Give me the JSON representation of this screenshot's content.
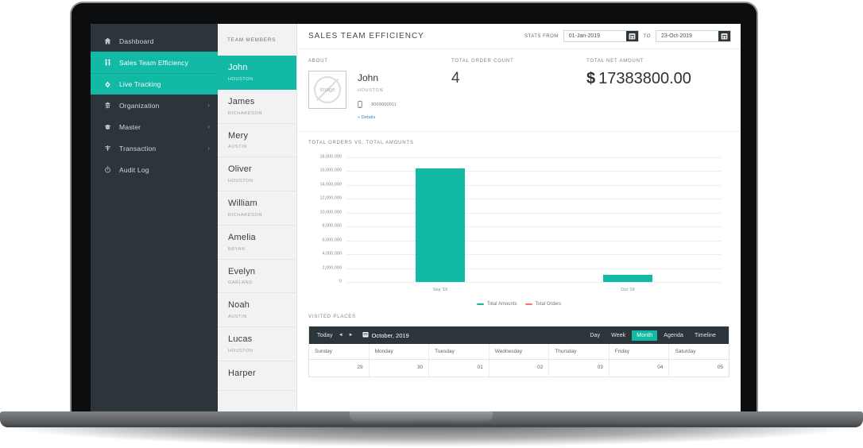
{
  "accent_color": "#12b9a4",
  "sidebar_color": "#2c3539",
  "sidebar": {
    "items": [
      {
        "label": "Dashboard",
        "icon": "home-icon",
        "active": false,
        "caret": ""
      },
      {
        "label": "Sales Team Efficiency",
        "icon": "people-icon",
        "active": true,
        "caret": ""
      },
      {
        "label": "Live Tracking",
        "icon": "location-icon",
        "active": true,
        "caret": ""
      },
      {
        "label": "Organization",
        "icon": "org-icon",
        "active": false,
        "caret": "›"
      },
      {
        "label": "Master",
        "icon": "master-icon",
        "active": false,
        "caret": "›"
      },
      {
        "label": "Transaction",
        "icon": "transaction-icon",
        "active": false,
        "caret": "›"
      },
      {
        "label": "Audit Log",
        "icon": "clock-icon",
        "active": false,
        "caret": ""
      }
    ]
  },
  "members_panel": {
    "title": "TEAM MEMBERS",
    "items": [
      {
        "name": "John",
        "city": "HOUSTON",
        "active": true
      },
      {
        "name": "James",
        "city": "RICHARDSON",
        "active": false
      },
      {
        "name": "Mery",
        "city": "AUSTIN",
        "active": false
      },
      {
        "name": "Oliver",
        "city": "HOUSTON",
        "active": false
      },
      {
        "name": "William",
        "city": "RICHARDSON",
        "active": false
      },
      {
        "name": "Amelia",
        "city": "BRYAN",
        "active": false
      },
      {
        "name": "Evelyn",
        "city": "GARLAND",
        "active": false
      },
      {
        "name": "Noah",
        "city": "AUSTIN",
        "active": false
      },
      {
        "name": "Lucas",
        "city": "HOUSTON",
        "active": false
      },
      {
        "name": "Harper",
        "city": "",
        "active": false
      }
    ]
  },
  "topbar": {
    "title": "SALES TEAM EFFICIENCY",
    "stats_from_label": "STATS FROM",
    "from_value": "01-Jan-2019",
    "to_label": "TO",
    "to_value": "23-Oct-2019"
  },
  "about": {
    "label": "ABOUT",
    "avatar_text": "Image",
    "name": "John",
    "city": "HOUSTON",
    "phone": "9000000011",
    "details_link": "» Details"
  },
  "order_count": {
    "label": "TOTAL ORDER COUNT",
    "value": "4"
  },
  "net_amount": {
    "label": "TOTAL NET AMOUNT",
    "currency": "$",
    "value": "17383800.00"
  },
  "chart_data": {
    "type": "bar",
    "title": "TOTAL ORDERS VS. TOTAL AMOUNTS",
    "categories": [
      "Sep '19",
      "Oct '19"
    ],
    "series": [
      {
        "name": "Total Amounts",
        "color": "#12b9a4",
        "values": [
          16350000,
          1050000
        ]
      },
      {
        "name": "Total Orders",
        "color": "#f4756a",
        "values": [
          0,
          0
        ]
      }
    ],
    "ylabel": "",
    "xlabel": "",
    "ylim": [
      0,
      18000000
    ],
    "yticks": [
      "18,000,000",
      "16,000,000",
      "14,000,000",
      "12,000,000",
      "10,000,000",
      "8,000,000",
      "6,000,000",
      "4,000,000",
      "2,000,000",
      "0"
    ],
    "ytick_values": [
      18000000,
      16000000,
      14000000,
      12000000,
      10000000,
      8000000,
      6000000,
      4000000,
      2000000,
      0
    ],
    "grid": true,
    "legend_position": "bottom",
    "legend": [
      "Total Amounts",
      "Total Orders"
    ]
  },
  "calendar": {
    "label": "VISITED PLACES",
    "today_label": "Today",
    "prev_icon": "◄",
    "next_icon": "►",
    "current_month": "October, 2019",
    "views": [
      {
        "label": "Day",
        "active": false
      },
      {
        "label": "Week",
        "active": false
      },
      {
        "label": "Month",
        "active": true
      },
      {
        "label": "Agenda",
        "active": false
      },
      {
        "label": "Timeline",
        "active": false
      }
    ],
    "day_headers": [
      "Sunday",
      "Monday",
      "Tuesday",
      "Wednesday",
      "Thursday",
      "Friday",
      "Saturday"
    ],
    "first_row": [
      "29",
      "30",
      "01",
      "02",
      "03",
      "04",
      "05"
    ]
  }
}
